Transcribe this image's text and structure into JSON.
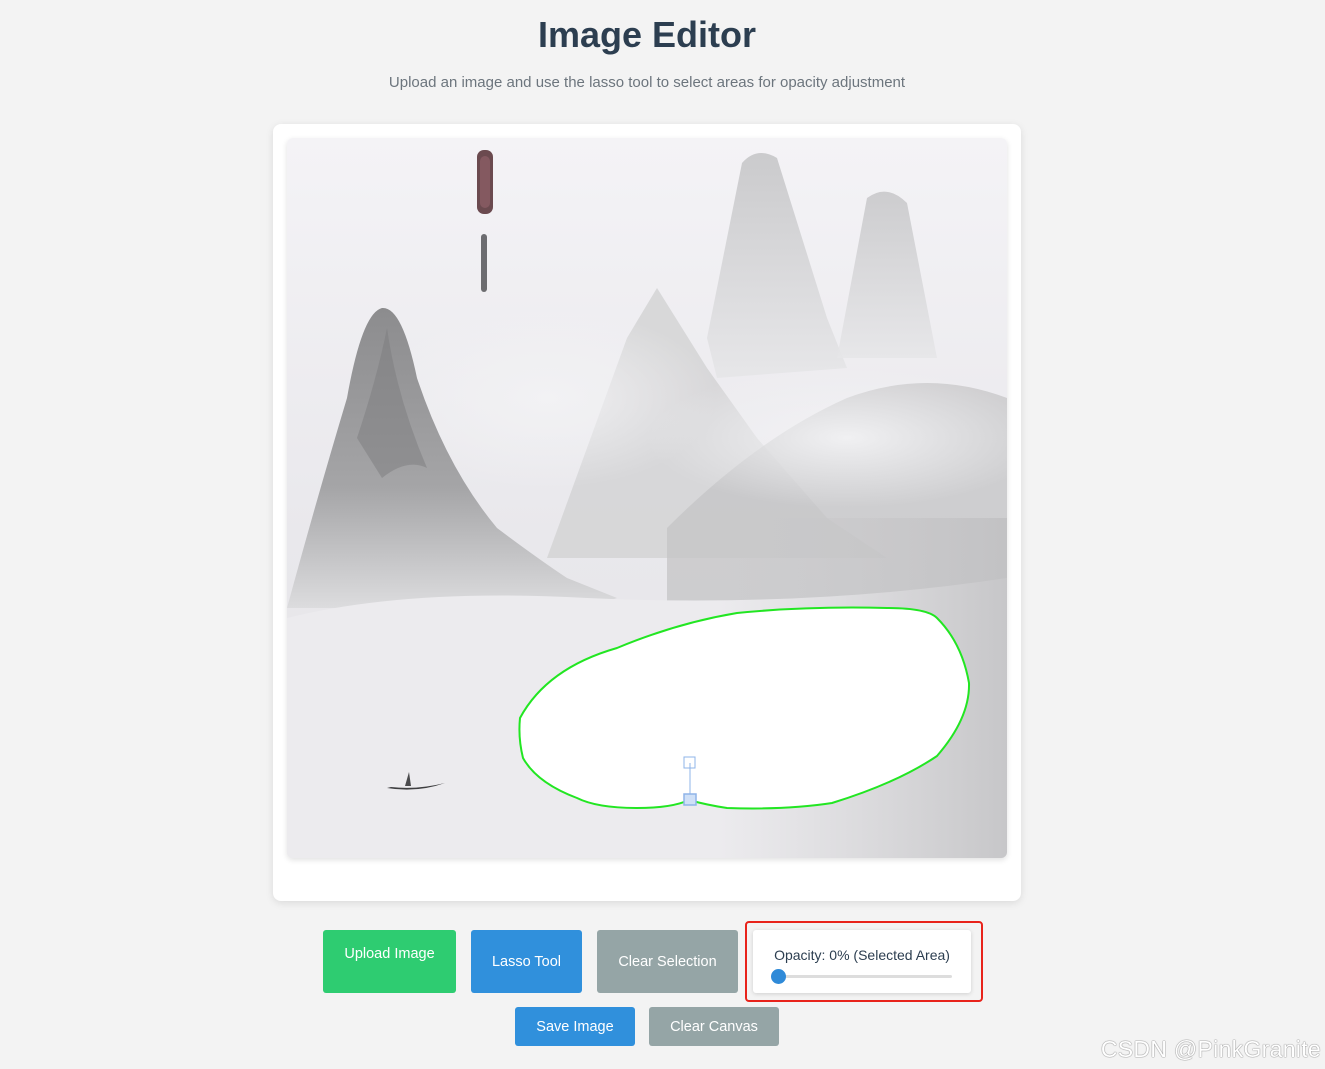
{
  "header": {
    "title": "Image Editor",
    "subtitle": "Upload an image and use the lasso tool to select areas for opacity adjustment"
  },
  "toolbar": {
    "upload_label": "Upload Image",
    "lasso_label": "Lasso Tool",
    "clear_selection_label": "Clear Selection",
    "save_label": "Save Image",
    "clear_canvas_label": "Clear Canvas"
  },
  "opacity": {
    "label": "Opacity: 0% (Selected Area)",
    "value_percent": 0
  },
  "selection": {
    "stroke_color": "#22e622"
  },
  "colors": {
    "upload": "#2ecc71",
    "primary": "#3090dc",
    "secondary": "#95a5a6",
    "highlight": "#e8231b"
  },
  "watermark": "CSDN @PinkGranite"
}
